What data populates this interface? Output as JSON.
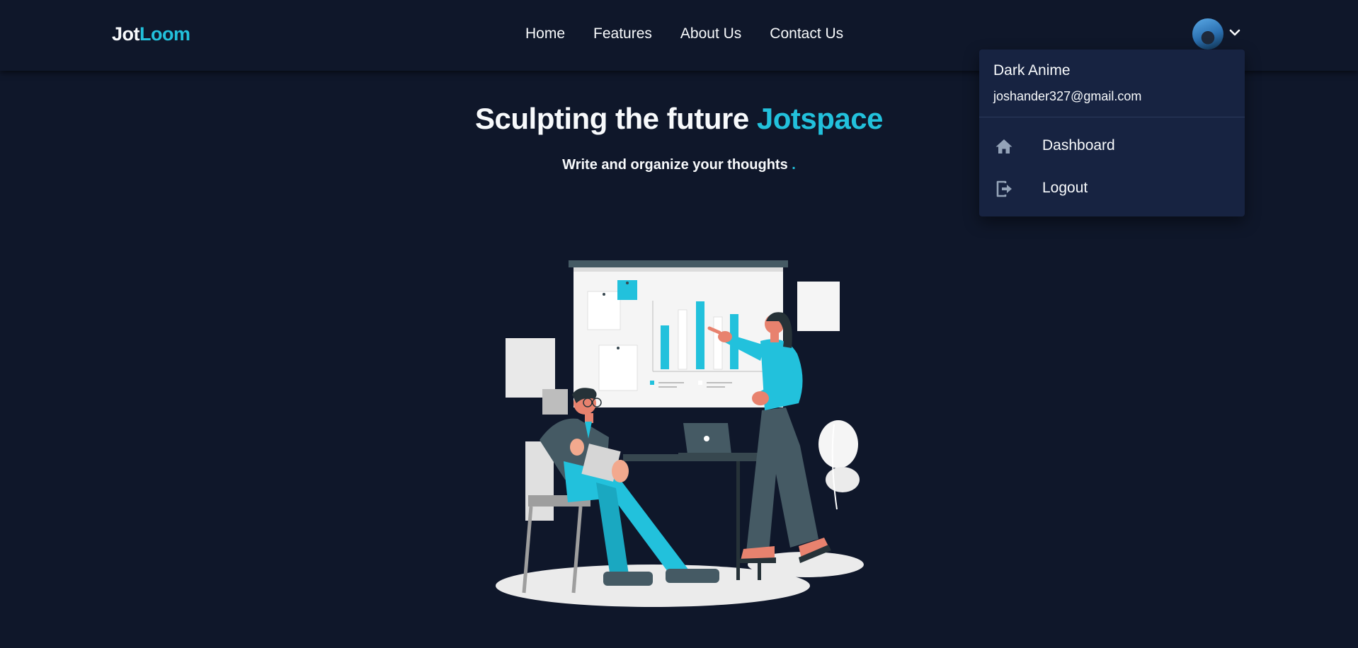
{
  "brand": {
    "part1": "Jot",
    "part2": "Loom"
  },
  "nav": {
    "links": [
      "Home",
      "Features",
      "About Us",
      "Contact Us"
    ]
  },
  "user_menu": {
    "avatar_icon": "avatar-image",
    "toggle_icon": "chevron-down-icon",
    "name": "Dark Anime",
    "email": "joshander327@gmail.com",
    "items": [
      {
        "label": "Dashboard",
        "icon": "home-icon"
      },
      {
        "label": "Logout",
        "icon": "logout-icon"
      }
    ]
  },
  "hero": {
    "title_part1": "Sculpting the future",
    "title_part2": "Jotspace",
    "subtitle": "Write and organize your thoughts",
    "subtitle_dot": "."
  },
  "colors": {
    "background": "#0f172a",
    "accent": "#22c1dc",
    "dropdown": "#172341",
    "text": "#f8fafc"
  }
}
